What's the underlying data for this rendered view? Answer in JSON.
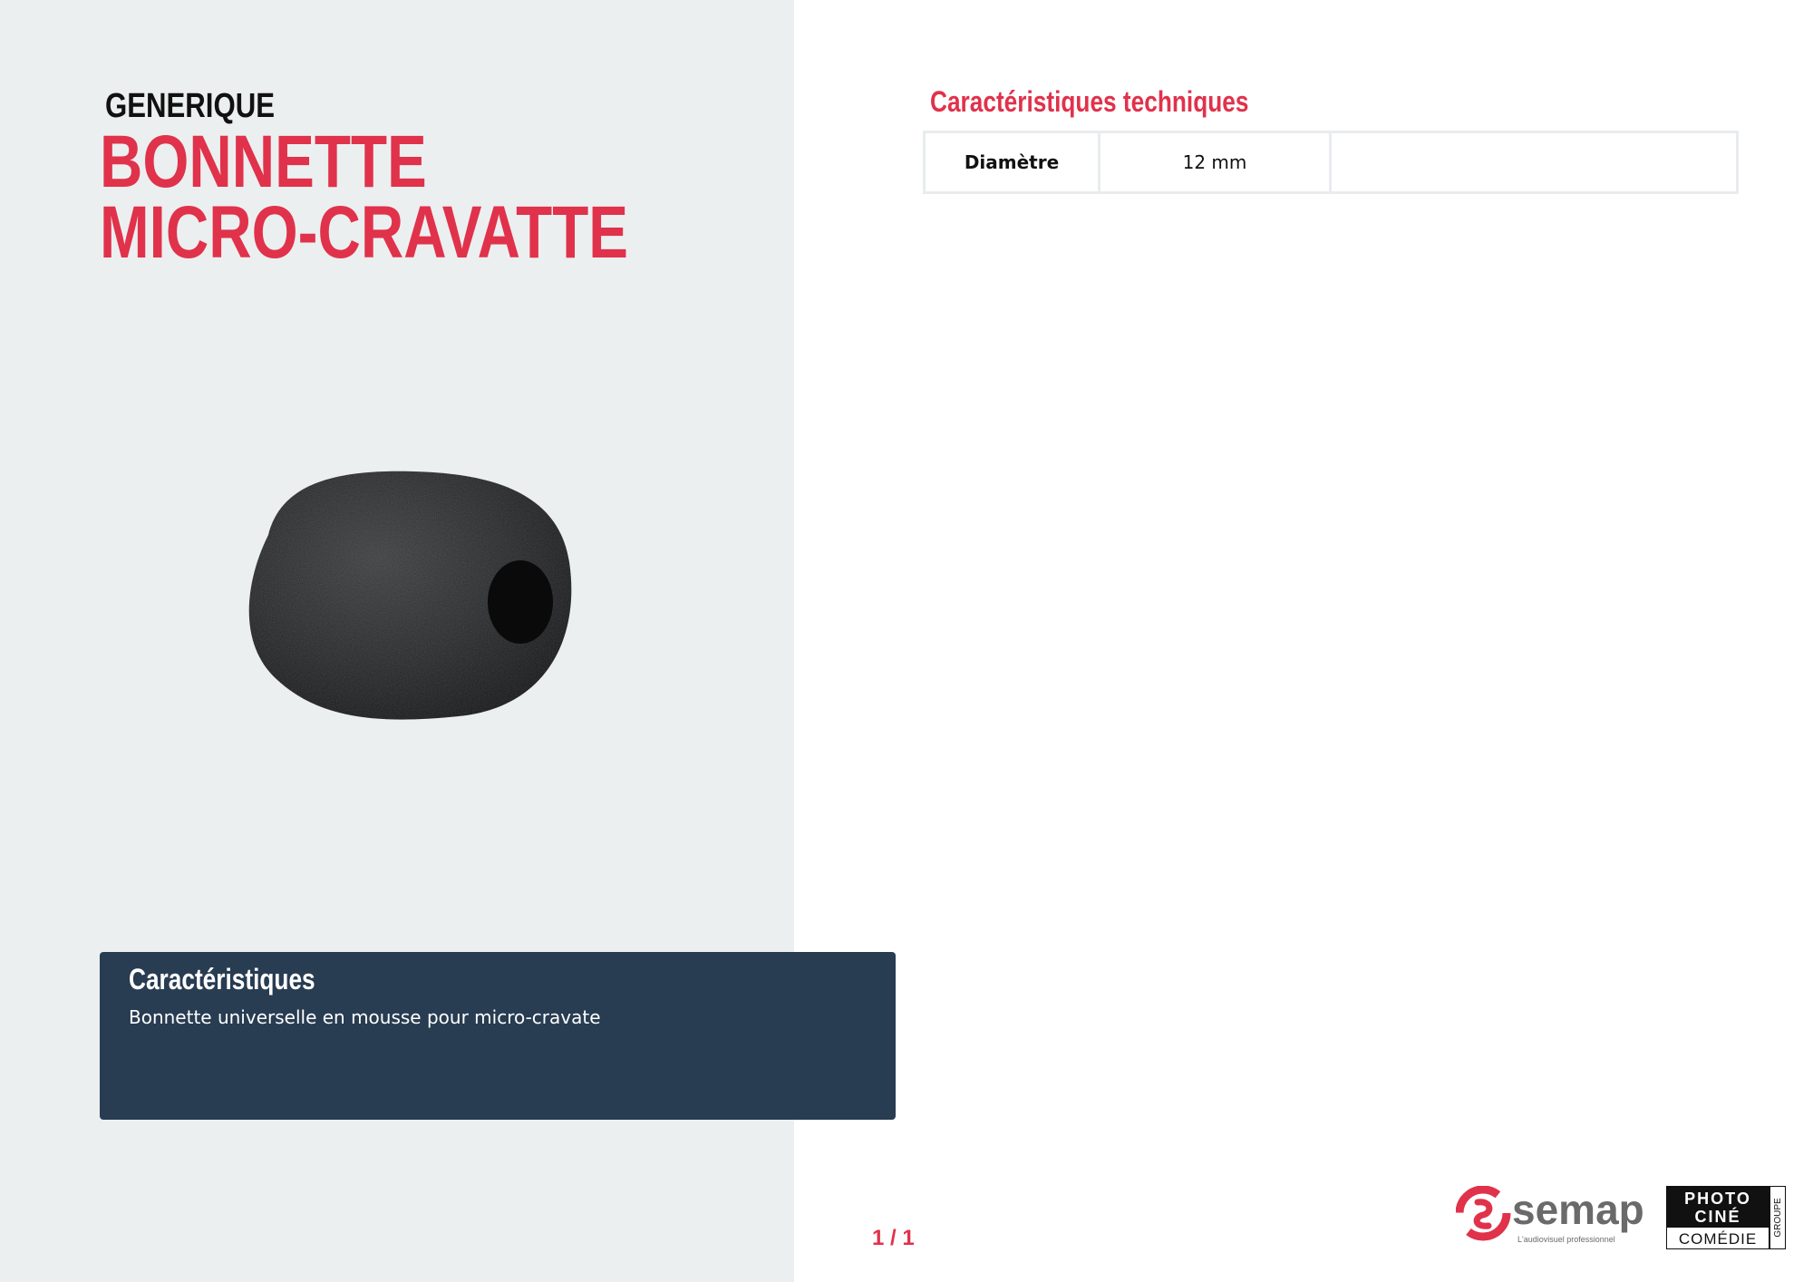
{
  "product": {
    "brand": "GENERIQUE",
    "title": "BONNETTE MICRO-CRAVATTE",
    "image_icon": "foam-windscreen-image"
  },
  "features": {
    "heading": "Caractéristiques",
    "text": "Bonnette universelle en mousse pour micro-cravate"
  },
  "technical": {
    "heading": "Caractéristiques techniques",
    "rows": [
      {
        "label": "Diamètre",
        "value": "12 mm",
        "extra": ""
      }
    ]
  },
  "footer": {
    "page_number": "1 / 1",
    "semap_logo": {
      "name": "semap",
      "tagline": "L'audiovisuel professionnel"
    },
    "pcc_logo": {
      "line1": "PHOTO",
      "line2": "CINÉ",
      "line3": "COMÉDIE",
      "side": "GROUPE"
    }
  },
  "colors": {
    "accent_red": "#e0324b",
    "panel_gray": "#eceff0",
    "box_navy": "#283c52"
  }
}
